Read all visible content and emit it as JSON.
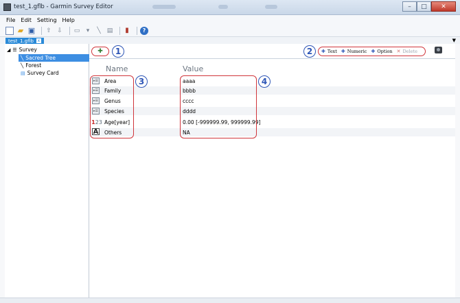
{
  "window": {
    "title": "test_1.gflb - Garmin Survey Editor",
    "buttons": {
      "minimize": "–",
      "maximize": "□",
      "close": "✕"
    }
  },
  "menu": [
    "File",
    "Edit",
    "Setting",
    "Help"
  ],
  "doc_tab": {
    "label": "test_1.gflb",
    "close": "x"
  },
  "tree": {
    "root": "Survey",
    "items": [
      "Sacred Tree",
      "Forest",
      "Survey Card"
    ],
    "selected": "Sacred Tree"
  },
  "toolbar_main": {
    "add_symbol": "✚",
    "actions": [
      {
        "symbol": "✚",
        "label": "Text"
      },
      {
        "symbol": "✚",
        "label": "Numeric"
      },
      {
        "symbol": "✚",
        "label": "Option"
      },
      {
        "symbol": "✕",
        "label": "Delete"
      }
    ]
  },
  "callouts": [
    "1",
    "2",
    "3",
    "4"
  ],
  "columns": {
    "name": "Name",
    "value": "Value"
  },
  "rows": [
    {
      "icon": "option-icon",
      "icon_text": "▸☰",
      "name": "Area",
      "value": "aaaa"
    },
    {
      "icon": "option-icon",
      "icon_text": "▸☰",
      "name": "Family",
      "value": "bbbb"
    },
    {
      "icon": "option-icon",
      "icon_text": "▸☰",
      "name": "Genus",
      "value": "cccc"
    },
    {
      "icon": "option-icon",
      "icon_text": "▸☰",
      "name": "Species",
      "value": "dddd"
    },
    {
      "icon": "numeric-icon",
      "icon_text": "23",
      "name": "Age[year]",
      "value": "0.00  [-999999.99, 999999.99]"
    },
    {
      "icon": "text-icon",
      "icon_text": "A",
      "name": "Others",
      "value": "NA"
    }
  ],
  "colors": {
    "highlight": "#d0343a",
    "callout": "#2d55b6",
    "selection": "#3d8ee2"
  }
}
